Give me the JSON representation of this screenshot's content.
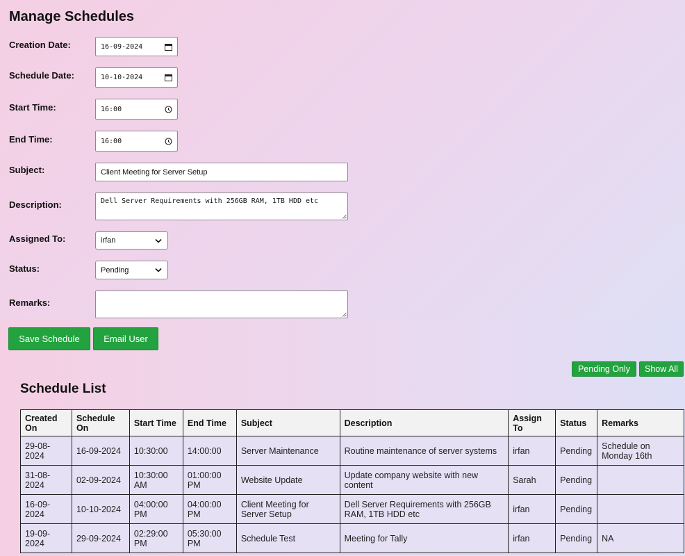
{
  "page": {
    "title": "Manage Schedules"
  },
  "form": {
    "creation_date": {
      "label": "Creation Date:",
      "value": "16-09-2024"
    },
    "schedule_date": {
      "label": "Schedule Date:",
      "value": "10-10-2024"
    },
    "start_time": {
      "label": "Start Time:",
      "value": "16:00"
    },
    "end_time": {
      "label": "End Time:",
      "value": "16:00"
    },
    "subject": {
      "label": "Subject:",
      "value": "Client Meeting for Server Setup"
    },
    "description": {
      "label": "Description:",
      "value": "Dell Server Requirements with 256GB RAM, 1TB HDD etc"
    },
    "assigned_to": {
      "label": "Assigned To:",
      "value": "irfan"
    },
    "status": {
      "label": "Status:",
      "value": "Pending"
    },
    "remarks": {
      "label": "Remarks:",
      "value": ""
    }
  },
  "actions": {
    "save": "Save Schedule",
    "email": "Email User"
  },
  "filters": {
    "pending_only": "Pending Only",
    "show_all": "Show All"
  },
  "list": {
    "title": "Schedule List",
    "columns": [
      "Created On",
      "Schedule On",
      "Start Time",
      "End Time",
      "Subject",
      "Description",
      "Assign To",
      "Status",
      "Remarks"
    ],
    "rows": [
      [
        "29-08-2024",
        "16-09-2024",
        "10:30:00",
        "14:00:00",
        "Server Maintenance",
        "Routine maintenance of server systems",
        "irfan",
        "Pending",
        "Schedule on Monday 16th"
      ],
      [
        "31-08-2024",
        "02-09-2024",
        "10:30:00 AM",
        "01:00:00 PM",
        "Website Update",
        "Update company website with new content",
        "Sarah",
        "Pending",
        ""
      ],
      [
        "16-09-2024",
        "10-10-2024",
        "04:00:00 PM",
        "04:00:00 PM",
        "Client Meeting for Server Setup",
        "Dell Server Requirements with 256GB RAM, 1TB HDD etc",
        "irfan",
        "Pending",
        ""
      ],
      [
        "19-09-2024",
        "29-09-2024",
        "02:29:00 PM",
        "05:30:00 PM",
        "Schedule Test",
        "Meeting for Tally",
        "irfan",
        "Pending",
        "NA"
      ]
    ]
  },
  "icons": {
    "calendar": "calendar-icon",
    "clock": "clock-icon",
    "chevron": "chevron-down-icon"
  },
  "colors": {
    "button_green": "#23a33f"
  }
}
